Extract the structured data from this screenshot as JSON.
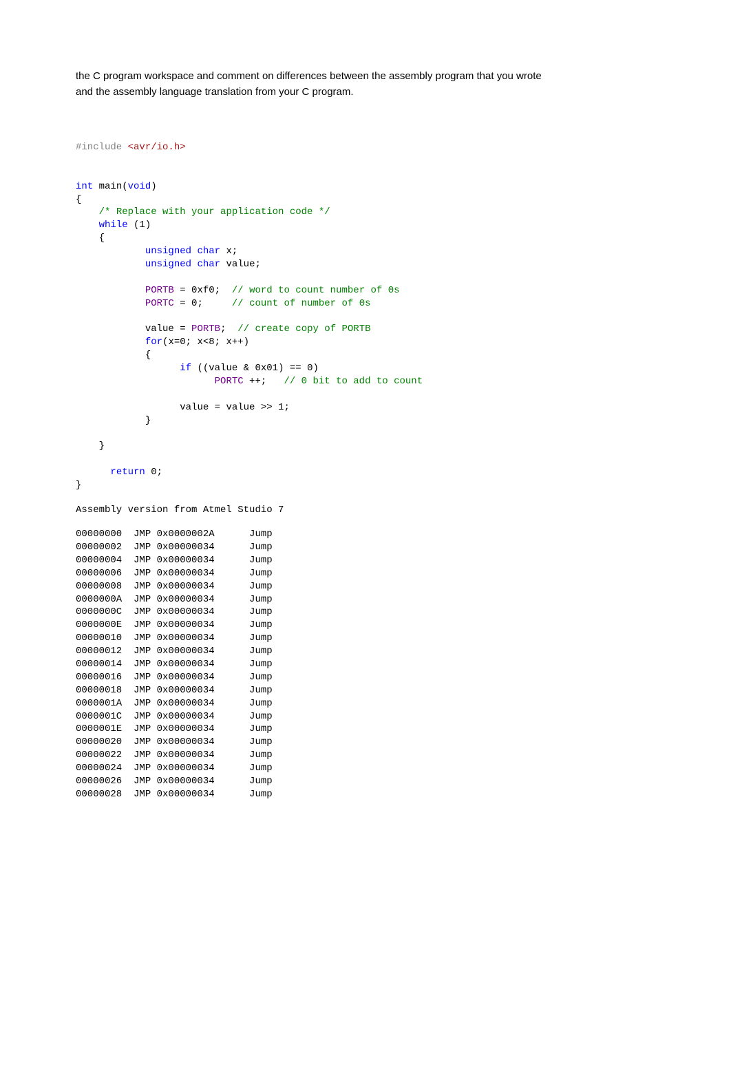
{
  "intro": {
    "line1": "the C program workspace and comment on differences between the assembly program that you wrote",
    "line2": "and the assembly language translation from your C program."
  },
  "code": {
    "include_kw": "#include",
    "include_val": " <avr/io.h>",
    "int_kw": "int",
    "main_name": " main(",
    "void_kw": "void",
    "main_close": ")",
    "brace_open": "{",
    "comment_replace": "/* Replace with your application code */",
    "while_kw": "while",
    "while_cond": " (1)",
    "inner_open": "{",
    "unsigned_kw": "unsigned",
    "char_kw": "char",
    "var_x": " x;",
    "var_value": " value;",
    "portb_id": "PORTB",
    "portb_assign": " = 0xf0;  ",
    "portb_comment": "// word to count number of 0s",
    "portc_id": "PORTC",
    "portc_assign": " = 0;     ",
    "portc_comment": "// count of number of 0s",
    "value_assign_pre": "value = ",
    "value_assign_post": ";  ",
    "value_comment": "// create copy of PORTB",
    "for_kw": "for",
    "for_cond": "(x=0; x<8; x++)",
    "for_open": "{",
    "if_kw": "if",
    "if_cond": " ((value & 0x01) == 0)",
    "portc_inc": " ++;   ",
    "portc_inc_comment": "// 0 bit to add to count",
    "value_shift": "value = value >> 1;",
    "for_close": "}",
    "inner_close": "}",
    "return_kw": "return",
    "return_val": " 0;",
    "brace_close": "}"
  },
  "asm": {
    "heading": "Assembly version from Atmel Studio 7",
    "rows": [
      {
        "addr": "00000000",
        "op": "JMP",
        "target": "0x0000002A",
        "desc": "Jump"
      },
      {
        "addr": "00000002",
        "op": "JMP",
        "target": "0x00000034",
        "desc": "Jump"
      },
      {
        "addr": "00000004",
        "op": "JMP",
        "target": "0x00000034",
        "desc": "Jump"
      },
      {
        "addr": "00000006",
        "op": "JMP",
        "target": "0x00000034",
        "desc": "Jump"
      },
      {
        "addr": "00000008",
        "op": "JMP",
        "target": "0x00000034",
        "desc": "Jump"
      },
      {
        "addr": "0000000A",
        "op": "JMP",
        "target": "0x00000034",
        "desc": "Jump"
      },
      {
        "addr": "0000000C",
        "op": "JMP",
        "target": "0x00000034",
        "desc": "Jump"
      },
      {
        "addr": "0000000E",
        "op": "JMP",
        "target": "0x00000034",
        "desc": "Jump"
      },
      {
        "addr": "00000010",
        "op": "JMP",
        "target": "0x00000034",
        "desc": "Jump"
      },
      {
        "addr": "00000012",
        "op": "JMP",
        "target": "0x00000034",
        "desc": "Jump"
      },
      {
        "addr": "00000014",
        "op": "JMP",
        "target": "0x00000034",
        "desc": "Jump"
      },
      {
        "addr": "00000016",
        "op": "JMP",
        "target": "0x00000034",
        "desc": "Jump"
      },
      {
        "addr": "00000018",
        "op": "JMP",
        "target": "0x00000034",
        "desc": "Jump"
      },
      {
        "addr": "0000001A",
        "op": "JMP",
        "target": "0x00000034",
        "desc": "Jump"
      },
      {
        "addr": "0000001C",
        "op": "JMP",
        "target": "0x00000034",
        "desc": "Jump"
      },
      {
        "addr": "0000001E",
        "op": "JMP",
        "target": "0x00000034",
        "desc": "Jump"
      },
      {
        "addr": "00000020",
        "op": "JMP",
        "target": "0x00000034",
        "desc": "Jump"
      },
      {
        "addr": "00000022",
        "op": "JMP",
        "target": "0x00000034",
        "desc": "Jump"
      },
      {
        "addr": "00000024",
        "op": "JMP",
        "target": "0x00000034",
        "desc": "Jump"
      },
      {
        "addr": "00000026",
        "op": "JMP",
        "target": "0x00000034",
        "desc": "Jump"
      },
      {
        "addr": "00000028",
        "op": "JMP",
        "target": "0x00000034",
        "desc": "Jump"
      }
    ]
  }
}
